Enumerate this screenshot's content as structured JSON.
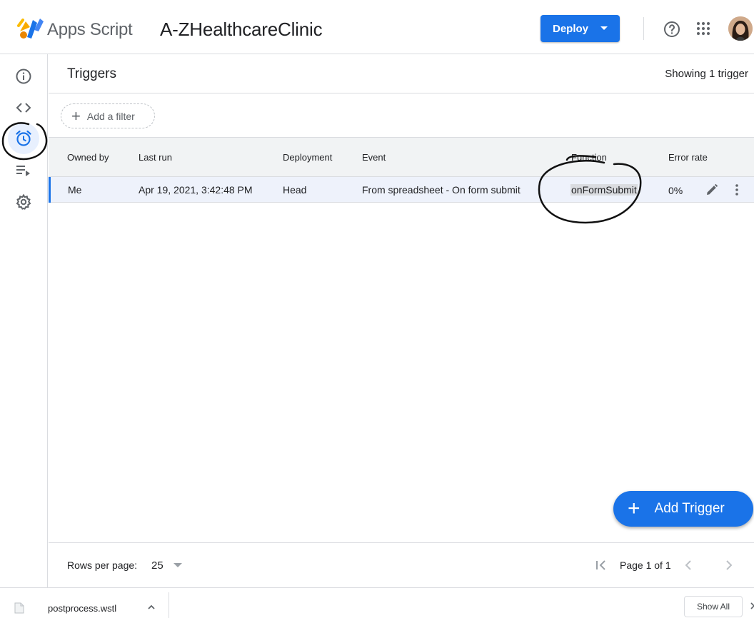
{
  "header": {
    "brand": "Apps Script",
    "project_title": "A-ZHealthcareClinic",
    "deploy_label": "Deploy",
    "icons": [
      "apps-script-logo",
      "help-icon",
      "apps-grid-icon",
      "avatar"
    ]
  },
  "sidebar": {
    "items": [
      {
        "name": "overview",
        "icon": "info-icon"
      },
      {
        "name": "editor",
        "icon": "code-icon"
      },
      {
        "name": "triggers",
        "icon": "alarm-clock-icon",
        "active": true
      },
      {
        "name": "executions",
        "icon": "executions-icon"
      },
      {
        "name": "settings",
        "icon": "gear-icon"
      }
    ]
  },
  "main": {
    "title": "Triggers",
    "showing": "Showing 1 trigger",
    "filter_label": "Add a filter",
    "columns": [
      "Owned by",
      "Last run",
      "Deployment",
      "Event",
      "Function",
      "Error rate"
    ],
    "rows": [
      {
        "owned_by": "Me",
        "last_run": "Apr 19, 2021, 3:42:48 PM",
        "deployment": "Head",
        "event": "From spreadsheet - On form submit",
        "function": "onFormSubmit",
        "error_rate": "0%"
      }
    ],
    "add_trigger_label": "Add Trigger",
    "pagination": {
      "rows_per_page_label": "Rows per page:",
      "rows_per_page_value": "25",
      "page_label": "Page 1 of 1"
    }
  },
  "download_bar": {
    "file_name": "postprocess.wstl",
    "show_all_label": "Show All"
  },
  "colors": {
    "accent": "#1a73e8",
    "active_bg": "#e8f0fe",
    "header_row_bg": "#f1f3f4",
    "selected_row_bg": "#eef2fb",
    "annotation_ink": "#111111"
  }
}
